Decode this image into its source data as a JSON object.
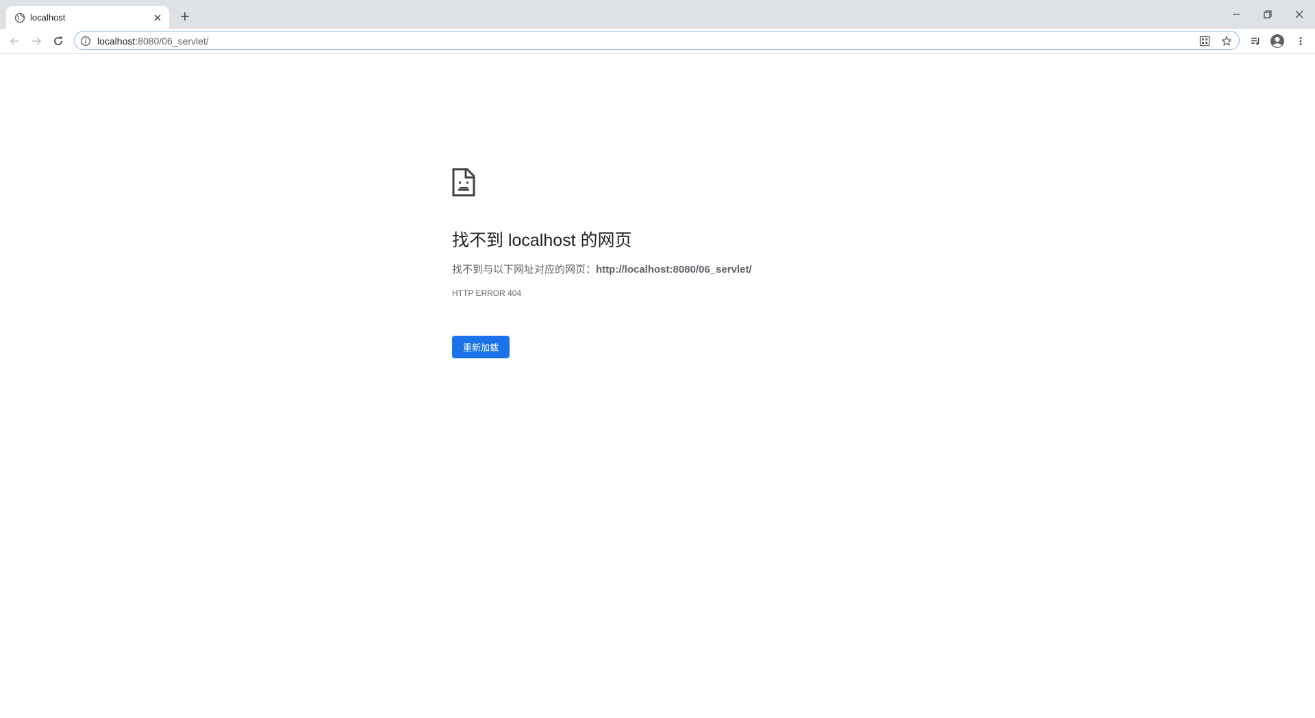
{
  "browser": {
    "tab": {
      "title": "localhost",
      "favicon": "globe-icon",
      "close_icon": "close-icon"
    },
    "new_tab_icon": "plus-icon",
    "window_controls": [
      "minimize-icon",
      "restore-icon",
      "close-icon"
    ],
    "toolbar": {
      "back_icon": "back-arrow-icon",
      "forward_icon": "forward-arrow-icon",
      "reload_icon": "reload-icon",
      "address": {
        "host": "localhost",
        "rest": ":8080/06_servlet/"
      },
      "right_icons": [
        "translate-icon",
        "star-icon",
        "media-icon",
        "profile-icon",
        "menu-icon"
      ]
    }
  },
  "error_page": {
    "icon": "sad-document-icon",
    "title": "找不到 localhost 的网页",
    "description_prefix": "找不到与以下网址对应的网页：",
    "description_url": "http://localhost:8080/06_servlet/",
    "error_code": "HTTP ERROR 404",
    "reload_button_label": "重新加载"
  },
  "colors": {
    "accent": "#1a73e8",
    "tabstrip": "#dee1e6",
    "text_primary": "#202124",
    "text_secondary": "#5f6368"
  }
}
